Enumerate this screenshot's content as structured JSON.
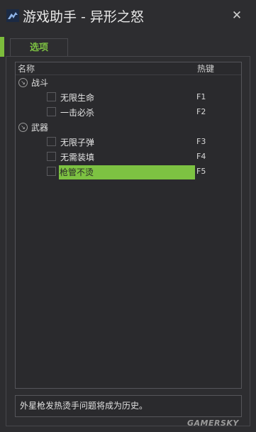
{
  "window": {
    "title": "游戏助手 - 异形之怒",
    "close_icon": "close-icon"
  },
  "tab": {
    "label": "选项"
  },
  "columns": {
    "name": "名称",
    "hotkey": "热键"
  },
  "groups": [
    {
      "label": "战斗",
      "items": [
        {
          "label": "无限生命",
          "hotkey": "F1",
          "checked": false,
          "selected": false
        },
        {
          "label": "一击必杀",
          "hotkey": "F2",
          "checked": false,
          "selected": false
        }
      ]
    },
    {
      "label": "武器",
      "items": [
        {
          "label": "无限子弹",
          "hotkey": "F3",
          "checked": false,
          "selected": false
        },
        {
          "label": "无需装填",
          "hotkey": "F4",
          "checked": false,
          "selected": false
        },
        {
          "label": "枪管不烫",
          "hotkey": "F5",
          "checked": false,
          "selected": true
        }
      ]
    }
  ],
  "status_text": "外星枪发热烫手问题将成为历史。",
  "watermark": "GAMERSKY",
  "colors": {
    "accent": "#7dc242",
    "background": "#2d2d30"
  }
}
